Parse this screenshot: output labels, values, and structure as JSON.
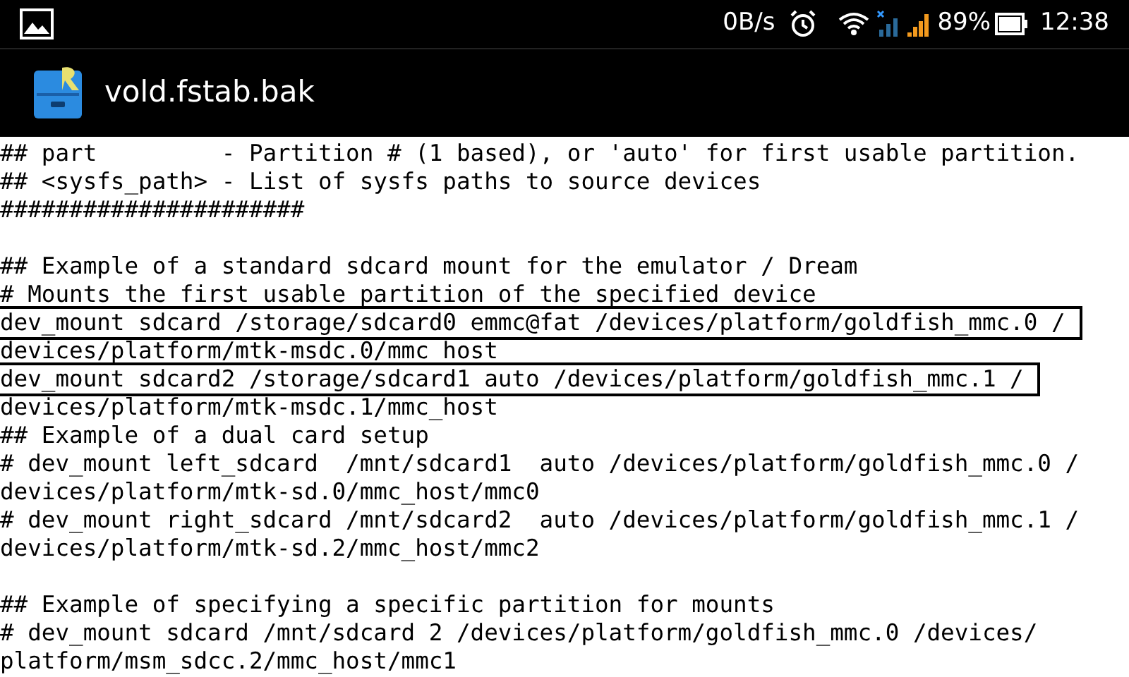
{
  "status_bar": {
    "speed": "0B/s",
    "battery": "89%",
    "time": "12:38"
  },
  "title_bar": {
    "title": "vold.fstab.bak"
  },
  "lines": [
    {
      "kind": "text",
      "text": "## part         - Partition # (1 based), or 'auto' for first usable partition.",
      "highlighted": false
    },
    {
      "kind": "text",
      "text": "## <sysfs_path> - List of sysfs paths to source devices",
      "highlighted": false
    },
    {
      "kind": "text",
      "text": "######################",
      "highlighted": false
    },
    {
      "kind": "blank"
    },
    {
      "kind": "text",
      "text": "## Example of a standard sdcard mount for the emulator / Dream",
      "highlighted": false
    },
    {
      "kind": "text",
      "text": "# Mounts the first usable partition of the specified device",
      "highlighted": false
    },
    {
      "kind": "text",
      "text": "dev_mount sdcard /storage/sdcard0 emmc@fat /devices/platform/goldfish_mmc.0 /",
      "highlighted": true
    },
    {
      "kind": "text",
      "text": "devices/platform/mtk-msdc.0/mmc_host",
      "highlighted": false
    },
    {
      "kind": "text",
      "text": "dev_mount sdcard2 /storage/sdcard1 auto /devices/platform/goldfish_mmc.1 /",
      "highlighted": true
    },
    {
      "kind": "text",
      "text": "devices/platform/mtk-msdc.1/mmc_host",
      "highlighted": false
    },
    {
      "kind": "text",
      "text": "## Example of a dual card setup",
      "highlighted": false
    },
    {
      "kind": "text",
      "text": "# dev_mount left_sdcard  /mnt/sdcard1  auto /devices/platform/goldfish_mmc.0 /",
      "highlighted": false
    },
    {
      "kind": "text",
      "text": "devices/platform/mtk-sd.0/mmc_host/mmc0",
      "highlighted": false
    },
    {
      "kind": "text",
      "text": "# dev_mount right_sdcard /mnt/sdcard2  auto /devices/platform/goldfish_mmc.1 /",
      "highlighted": false
    },
    {
      "kind": "text",
      "text": "devices/platform/mtk-sd.2/mmc_host/mmc2",
      "highlighted": false
    },
    {
      "kind": "blank"
    },
    {
      "kind": "text",
      "text": "## Example of specifying a specific partition for mounts",
      "highlighted": false
    },
    {
      "kind": "text",
      "text": "# dev_mount sdcard /mnt/sdcard 2 /devices/platform/goldfish_mmc.0 /devices/",
      "highlighted": false
    },
    {
      "kind": "text",
      "text": "platform/msm_sdcc.2/mmc_host/mmc1",
      "highlighted": false
    }
  ]
}
